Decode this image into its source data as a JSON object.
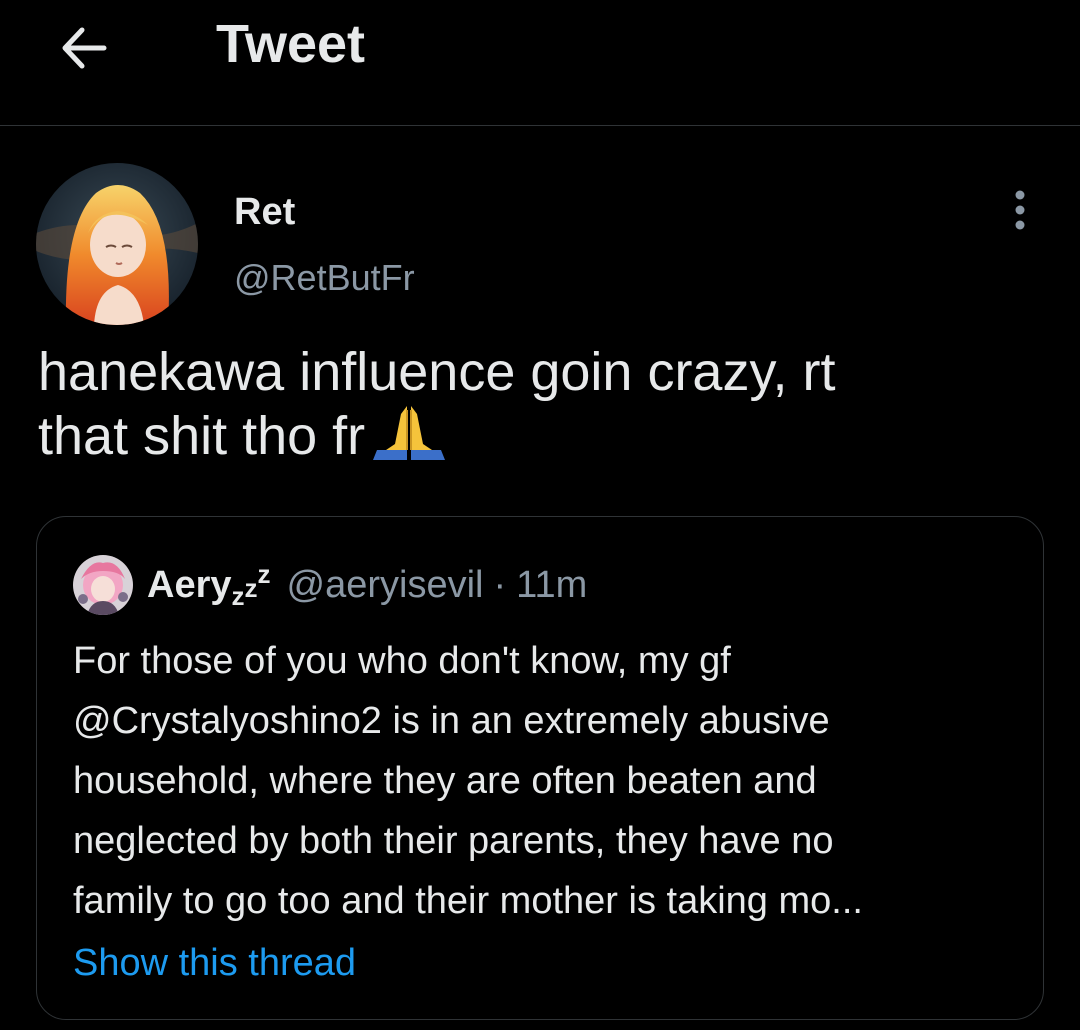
{
  "header": {
    "back_icon": "arrow-left-icon",
    "title": "Tweet"
  },
  "tweet": {
    "display_name": "Ret",
    "handle": "@RetButFr",
    "more_icon": "vertical-ellipsis-icon",
    "text_line1": "hanekawa influence goin crazy, rt",
    "text_line2": "that shit tho fr",
    "emoji": "folded-hands-emoji"
  },
  "quote": {
    "display_name": "Aery",
    "name_suffix_1": "z",
    "name_suffix_2": "z",
    "handle": "@aeryisevil",
    "separator": "·",
    "time": "11m",
    "body_lines": [
      "For those of you who don't know, my gf",
      "@Crystalyoshino2 is in an extremely abusive",
      "household, where they are often beaten and",
      "neglected by both their parents, they have no",
      "family to go too and their mother is taking mo..."
    ],
    "show_thread_label": "Show this thread"
  },
  "colors": {
    "background": "#000000",
    "text_primary": "#e7e9ea",
    "text_secondary": "#8b98a5",
    "link": "#1d9bf0",
    "border": "#2f3336"
  }
}
